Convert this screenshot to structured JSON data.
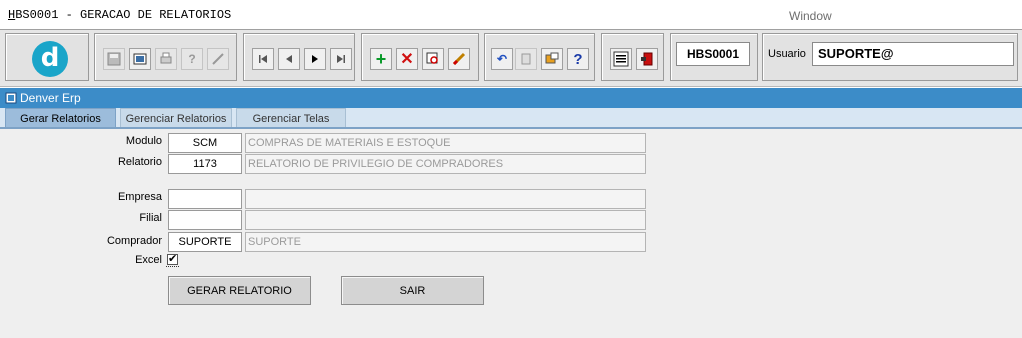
{
  "titlebar": {
    "app_title_first": "H",
    "app_title_rest": "BS0001 - GERACAO DE RELATORIOS",
    "window_menu": "Window"
  },
  "toolbar": {
    "logo_letter": "d",
    "form_id": "HBS0001",
    "usuario_label": "Usuario",
    "usuario_value": "SUPORTE@",
    "icons": [
      "save-icon",
      "screen-icon",
      "print-icon",
      "help-query-icon",
      "edit-disabled-icon",
      "first-record-icon",
      "previous-record-icon",
      "next-record-icon",
      "last-record-icon",
      "add-record-icon",
      "delete-record-icon",
      "search-icon",
      "clear-icon",
      "undo-icon",
      "copy-icon",
      "list-icon",
      "help-icon",
      "menu-icon",
      "exit-icon"
    ]
  },
  "window": {
    "title": "Denver Erp",
    "tabs": [
      "Gerar Relatorios",
      "Gerenciar Relatorios",
      "Gerenciar Telas"
    ],
    "active_tab": "Gerar Relatorios"
  },
  "form": {
    "modulo_label": "Modulo",
    "modulo_code": "SCM",
    "modulo_desc": "COMPRAS DE MATERIAIS E ESTOQUE",
    "relatorio_label": "Relatorio",
    "relatorio_code": "1173",
    "relatorio_desc": "RELATORIO DE PRIVILEGIO DE COMPRADORES",
    "empresa_label": "Empresa",
    "empresa_code": "",
    "empresa_desc": "",
    "filial_label": "Filial",
    "filial_code": "",
    "filial_desc": "",
    "comprador_label": "Comprador",
    "comprador_code": "SUPORTE",
    "comprador_desc": "SUPORTE",
    "excel_label": "Excel",
    "excel_checked": "✔",
    "gerar_button": "GERAR RELATORIO",
    "sair_button": "SAIR"
  },
  "colors": {
    "window_header": "#3c8cc8",
    "logo": "#1aa5c9",
    "active_tab": "#9cbcdb"
  }
}
